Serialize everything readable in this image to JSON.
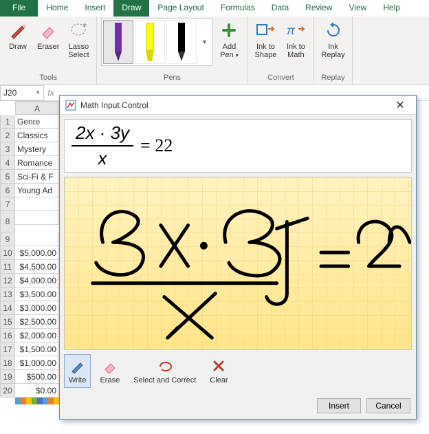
{
  "tabs": {
    "file": "File",
    "home": "Home",
    "insert": "Insert",
    "draw": "Draw",
    "pageLayout": "Page Layout",
    "formulas": "Formulas",
    "data": "Data",
    "review": "Review",
    "view": "View",
    "help": "Help",
    "active": "Draw"
  },
  "ribbon": {
    "tools": {
      "label": "Tools",
      "draw": "Draw",
      "eraser": "Eraser",
      "lasso1": "Lasso",
      "lasso2": "Select"
    },
    "pens": {
      "label": "Pens",
      "add1": "Add",
      "add2": "Pen",
      "colors": [
        "#7030a0",
        "#ffff00",
        "#000000"
      ]
    },
    "convert": {
      "label": "Convert",
      "shape1": "Ink to",
      "shape2": "Shape",
      "math1": "Ink to",
      "math2": "Math"
    },
    "replay": {
      "label": "Replay",
      "btn1": "Ink",
      "btn2": "Replay"
    }
  },
  "namebox": "J20",
  "grid": {
    "cols": [
      "A"
    ],
    "rows": [
      {
        "n": "1",
        "a": "Genre"
      },
      {
        "n": "2",
        "a": "Classics"
      },
      {
        "n": "3",
        "a": "Mystery"
      },
      {
        "n": "4",
        "a": "Romance"
      },
      {
        "n": "5",
        "a": "Sci-Fi & Fantasy",
        "clip": "Sci-Fi & F"
      },
      {
        "n": "6",
        "a": "Young Adult",
        "clip": "Young Ad"
      },
      {
        "n": "7",
        "a": ""
      },
      {
        "n": "8",
        "a": ""
      },
      {
        "n": "9",
        "a": ""
      },
      {
        "n": "10",
        "a": "$5,000.00",
        "right": true
      },
      {
        "n": "11",
        "a": "$4,500.00",
        "right": true
      },
      {
        "n": "12",
        "a": "$4,000.00",
        "right": true
      },
      {
        "n": "13",
        "a": "$3,500.00",
        "right": true
      },
      {
        "n": "14",
        "a": "$3,000.00",
        "right": true
      },
      {
        "n": "15",
        "a": "$2,500.00",
        "right": true
      },
      {
        "n": "16",
        "a": "$2,000.00",
        "right": true
      },
      {
        "n": "17",
        "a": "$1,500.00",
        "right": true
      },
      {
        "n": "18",
        "a": "$1,000.00",
        "right": true
      },
      {
        "n": "19",
        "a": "$500.00",
        "right": true
      },
      {
        "n": "20",
        "a": "$0.00",
        "right": true
      }
    ]
  },
  "dialog": {
    "title": "Math Input Control",
    "equation": {
      "numerator": "2x · 3y",
      "denominator": "x",
      "rhs": "= 22"
    },
    "tools": {
      "write": "Write",
      "erase": "Erase",
      "select": "Select and Correct",
      "clear": "Clear"
    },
    "buttons": {
      "insert": "Insert",
      "cancel": "Cancel"
    }
  }
}
